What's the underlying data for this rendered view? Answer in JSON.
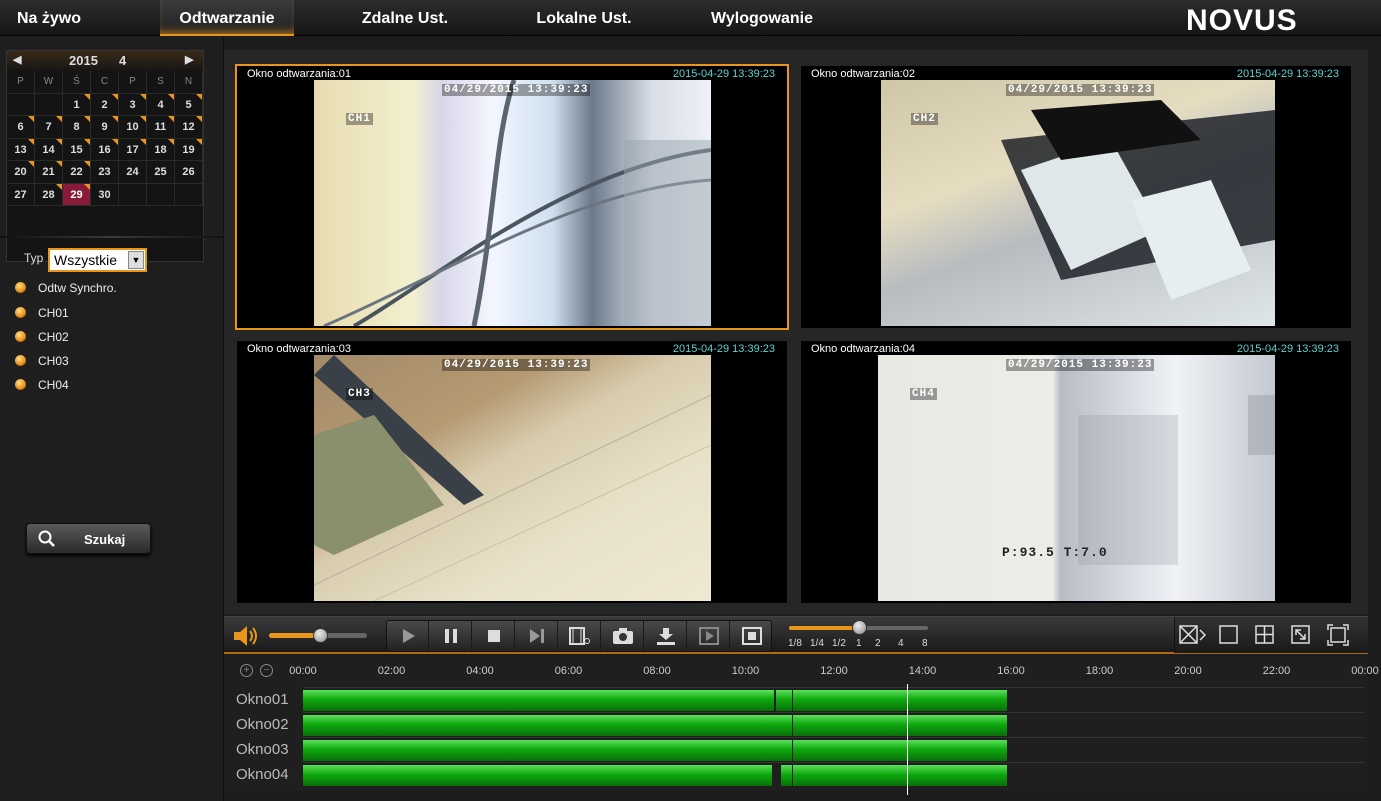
{
  "nav": {
    "items": [
      "Na żywo",
      "Odtwarzanie",
      "Zdalne Ust.",
      "Lokalne Ust.",
      "Wylogowanie"
    ],
    "active": "Odtwarzanie",
    "logo": "NOVUS"
  },
  "calendar": {
    "year": "2015",
    "month": "4",
    "weekdays": [
      "P",
      "W",
      "Ś",
      "C",
      "P",
      "S",
      "N"
    ],
    "days": [
      "",
      "",
      "1",
      "2",
      "3",
      "4",
      "5",
      "6",
      "7",
      "8",
      "9",
      "10",
      "11",
      "12",
      "13",
      "14",
      "15",
      "16",
      "17",
      "18",
      "19",
      "20",
      "21",
      "22",
      "23",
      "24",
      "25",
      "26",
      "27",
      "28",
      "29",
      "30",
      "",
      "",
      ""
    ],
    "selected_day": "29",
    "recorded_days": [
      "1",
      "2",
      "3",
      "4",
      "5",
      "6",
      "7",
      "8",
      "9",
      "10",
      "11",
      "12",
      "13",
      "14",
      "15",
      "16",
      "17",
      "18",
      "19",
      "20",
      "21",
      "22",
      "28",
      "29"
    ]
  },
  "filter": {
    "type_label": "Typ",
    "type_value": "Wszystkie"
  },
  "channels": [
    "Odtw Synchro.",
    "CH01",
    "CH02",
    "CH03",
    "CH04"
  ],
  "search_button": "Szukaj",
  "windows": [
    {
      "title": "Okno odtwarzania:01",
      "timestamp": "2015-04-29 13:39:23",
      "osd_time": "04/29/2015 13:39:23",
      "osd_channel": "CH1"
    },
    {
      "title": "Okno odtwarzania:02",
      "timestamp": "2015-04-29 13:39:23",
      "osd_time": "04/29/2015 13:39:23",
      "osd_channel": "CH2"
    },
    {
      "title": "Okno odtwarzania:03",
      "timestamp": "2015-04-29 13:39:23",
      "osd_time": "04/29/2015 13:39:23",
      "osd_channel": "CH3"
    },
    {
      "title": "Okno odtwarzania:04",
      "timestamp": "2015-04-29 13:39:23",
      "osd_time": "04/29/2015 13:39:23",
      "osd_channel": "CH4",
      "osd_extra": "P:93.5   T:7.0"
    }
  ],
  "controls": {
    "volume_level": 0.52,
    "speed_labels": [
      "1/8",
      "1/4",
      "1/2",
      "1",
      "2",
      "4",
      "8"
    ],
    "speed_value": "1",
    "colors": {
      "accent": "#e8951c",
      "record": "#0ea80e",
      "timestamp": "#5fd0d0",
      "selected_day": "#8a1a3a"
    }
  },
  "timeline": {
    "hours": [
      "00:00",
      "02:00",
      "04:00",
      "06:00",
      "08:00",
      "10:00",
      "12:00",
      "14:00",
      "16:00",
      "18:00",
      "20:00",
      "22:00",
      "00:00"
    ],
    "tracks": [
      {
        "name": "Okno01",
        "segments": [
          [
            0,
            10.65
          ],
          [
            10.7,
            11.05
          ],
          [
            11.08,
            15.9
          ]
        ]
      },
      {
        "name": "Okno02",
        "segments": [
          [
            0,
            11.05
          ],
          [
            11.08,
            15.9
          ]
        ]
      },
      {
        "name": "Okno03",
        "segments": [
          [
            0,
            11.05
          ],
          [
            11.08,
            15.9
          ]
        ]
      },
      {
        "name": "Okno04",
        "segments": [
          [
            0,
            10.6
          ],
          [
            10.8,
            11.05
          ],
          [
            11.08,
            15.9
          ]
        ]
      }
    ],
    "cursor_hour": 13.66
  }
}
